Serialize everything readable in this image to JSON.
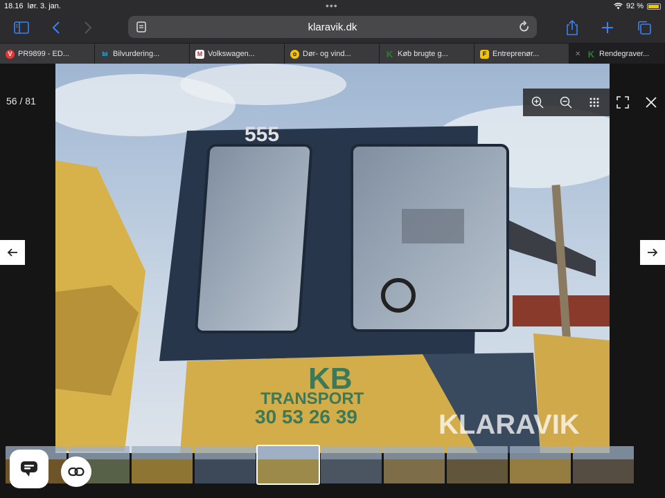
{
  "status": {
    "time": "18.16",
    "date": "lør. 3. jan.",
    "battery": "92 %",
    "battery_level": 0.92
  },
  "toolbar": {
    "url": "klaravik.dk",
    "icons": [
      "sidebar-icon",
      "back-icon",
      "forward-icon",
      "share-icon",
      "new-tab-icon",
      "tabs-overview-icon"
    ]
  },
  "tabs": [
    {
      "label": "PR9899 - ED...",
      "favicon": "V",
      "color": "#e53935"
    },
    {
      "label": "Bilvurdering...",
      "favicon": "bi",
      "color": "#29b6f6"
    },
    {
      "label": "Volkswagen...",
      "favicon": "M",
      "color": "#ffffff"
    },
    {
      "label": "Dør- og vind...",
      "favicon": "o",
      "color": "#f5c400"
    },
    {
      "label": "Køb brugte g...",
      "favicon": "K",
      "color": "#2e7d32"
    },
    {
      "label": "Entreprenør...",
      "favicon": "F",
      "color": "#f5c400"
    },
    {
      "label": "Rendegraver...",
      "favicon": "K",
      "color": "#2e7d32",
      "active": true
    }
  ],
  "viewer": {
    "counter": "56 / 81",
    "controls": [
      "zoom-in-icon",
      "zoom-out-icon",
      "grid-icon",
      "fullscreen-icon",
      "close-icon"
    ],
    "photo_text": {
      "cab_number": "555",
      "logo": "KB",
      "company": "TRANSPORT",
      "phone": "30 53 26 39",
      "watermark": "KLARAVIK"
    }
  },
  "thumbnails": {
    "count": 10,
    "selected_index": 4
  }
}
